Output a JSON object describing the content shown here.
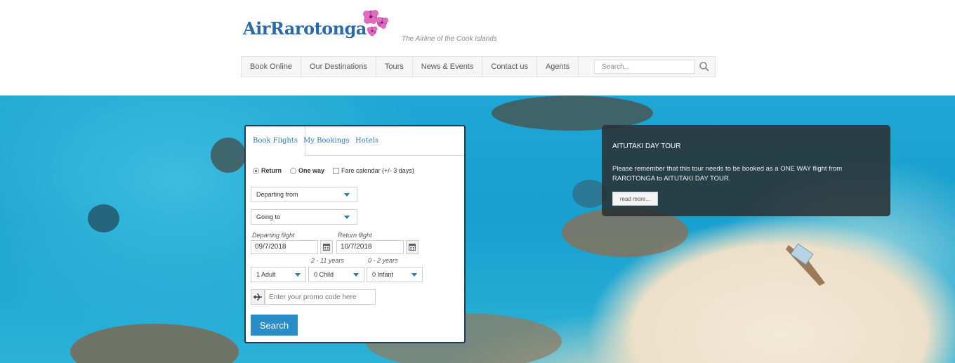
{
  "brand": {
    "name": "AirRarotonga",
    "tagline": "The Airline of the Cook Islands"
  },
  "nav": {
    "items": [
      "Book Online",
      "Our Destinations",
      "Tours",
      "News & Events",
      "Contact us",
      "Agents"
    ],
    "search_placeholder": "Search..."
  },
  "booking": {
    "tabs": [
      "Book Flights",
      "My Bookings",
      "Hotels"
    ],
    "active_tab": "Book Flights",
    "trip_type": {
      "return_label": "Return",
      "one_way_label": "One way",
      "fare_calendar_label": "Fare calendar (+/- 3 days)",
      "selected": "Return"
    },
    "departing_from": "Departing from",
    "going_to": "Going to",
    "departing_flight_label": "Departing flight",
    "return_flight_label": "Return flight",
    "departing_date": "09/7/2018",
    "return_date": "10/7/2018",
    "child_hint": "2 - 11 years",
    "infant_hint": "0 - 2 years",
    "adults": "1 Adult",
    "children": "0 Child",
    "infants": "0 Infant",
    "promo_placeholder": "Enter your promo code here",
    "search_label": "Search"
  },
  "promo_panel": {
    "title": "AITUTAKI DAY TOUR",
    "text": "Please remember that this tour needs to be booked as a ONE WAY flight from RAROTONGA to AITUTAKI DAY TOUR.",
    "read_more_label": "read more..."
  },
  "icons": {
    "search": "search-icon",
    "calendar": "calendar-icon",
    "plane": "plane-icon",
    "dropdown": "chevron-down-icon"
  },
  "colors": {
    "brand_blue": "#2a6aa8",
    "accent_blue": "#2a8dc7",
    "logo_flower": "#c23a9b",
    "panel_dark": "#2a2e30"
  }
}
